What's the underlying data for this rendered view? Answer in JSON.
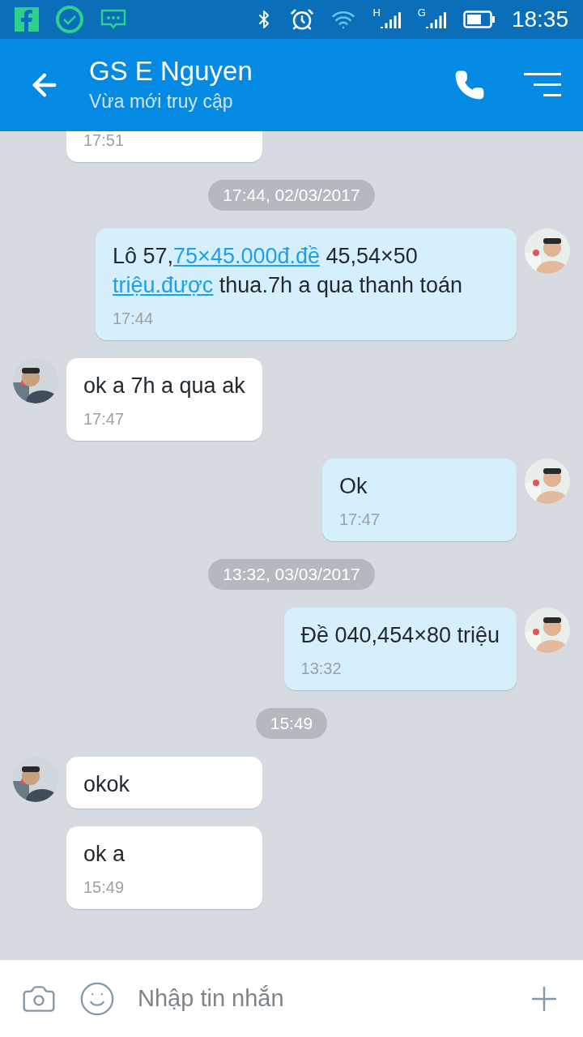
{
  "status_bar": {
    "network_1": "H",
    "network_2": "G",
    "time": "18:35"
  },
  "header": {
    "title": "GS E Nguyen",
    "subtitle": "Vừa mới truy cập"
  },
  "messages": [
    {
      "kind": "message",
      "outgoing": false,
      "avatar": false,
      "time": "17:51",
      "clipped": true
    },
    {
      "kind": "date",
      "text": "17:44, 02/03/2017"
    },
    {
      "kind": "message",
      "outgoing": true,
      "avatar": true,
      "parts": [
        {
          "text": "Lô 57,",
          "link": false
        },
        {
          "text": "75×45.000đ.đề",
          "link": true
        },
        {
          "text": " 45,54×50 ",
          "link": false
        },
        {
          "text": "triệu.được",
          "link": true
        },
        {
          "text": " thua.7h a qua thanh toán",
          "link": false
        }
      ],
      "time": "17:44"
    },
    {
      "kind": "message",
      "outgoing": false,
      "avatar": true,
      "parts": [
        {
          "text": "ok a 7h a qua ak",
          "link": false
        }
      ],
      "time": "17:47"
    },
    {
      "kind": "message",
      "outgoing": true,
      "avatar": true,
      "parts": [
        {
          "text": "Ok",
          "link": false
        }
      ],
      "time": "17:47"
    },
    {
      "kind": "date",
      "text": "13:32, 03/03/2017"
    },
    {
      "kind": "message",
      "outgoing": true,
      "avatar": true,
      "parts": [
        {
          "text": "Đề 040,454×80 triệu",
          "link": false
        }
      ],
      "time": "13:32"
    },
    {
      "kind": "date",
      "text": "15:49"
    },
    {
      "kind": "message",
      "outgoing": false,
      "avatar": true,
      "parts": [
        {
          "text": "okok",
          "link": false
        }
      ]
    },
    {
      "kind": "message",
      "outgoing": false,
      "avatar": false,
      "parts": [
        {
          "text": "ok a",
          "link": false
        }
      ],
      "time": "15:49"
    }
  ],
  "composer": {
    "placeholder": "Nhập tin nhắn"
  }
}
